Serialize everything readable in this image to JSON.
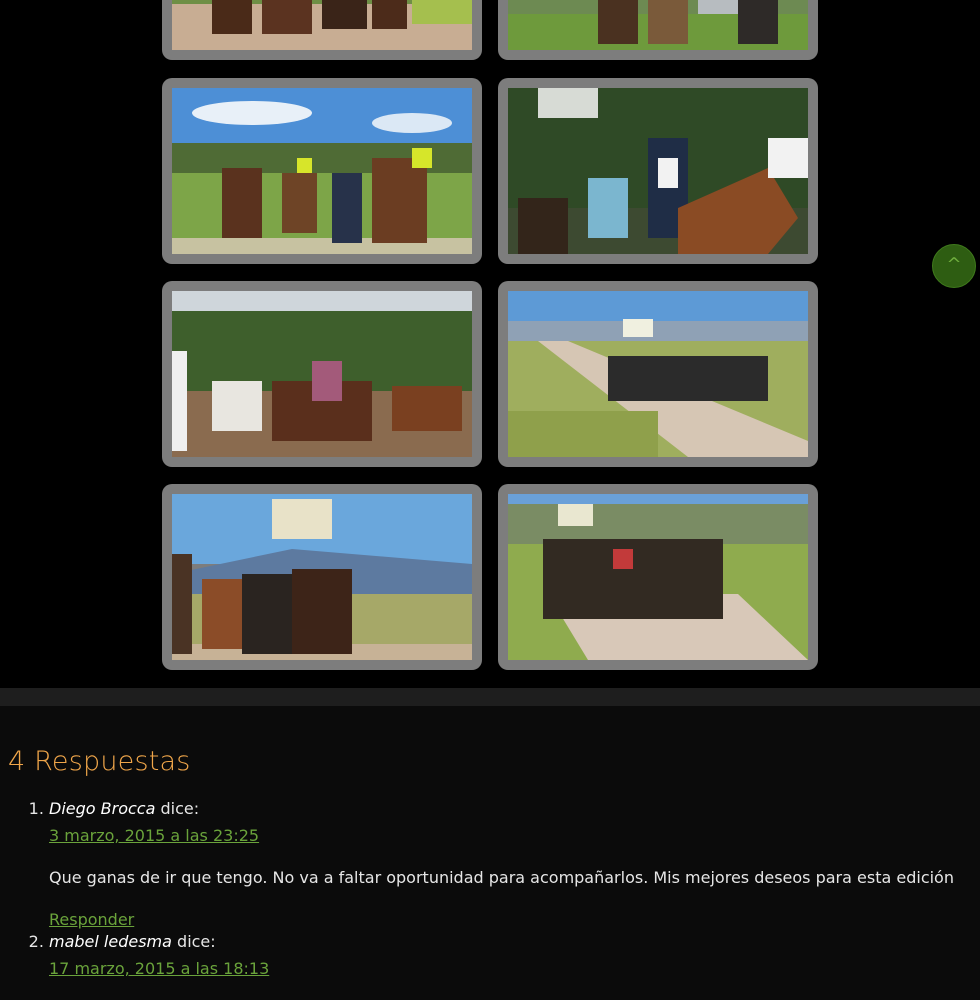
{
  "gallery": {
    "photos": [
      {
        "name": "photo-riders-dirt-road-top-left"
      },
      {
        "name": "photo-riders-with-car-top-right"
      },
      {
        "name": "photo-riders-with-vests-and-flags"
      },
      {
        "name": "photo-woman-on-brown-horse"
      },
      {
        "name": "photo-riders-in-yard"
      },
      {
        "name": "photo-cavalcade-on-road-with-flag"
      },
      {
        "name": "photo-riders-carrying-flag-mountains"
      },
      {
        "name": "photo-cavalcade-approaching-on-road"
      }
    ]
  },
  "to_top_button": {
    "label": "^"
  },
  "comments": {
    "title": "4 Respuestas",
    "items": [
      {
        "author": "Diego Brocca",
        "says": "dice:",
        "date": "3 marzo, 2015 a las 23:25",
        "text": "Que ganas de ir que tengo. No va a faltar oportunidad para acompañarlos. Mis mejores deseos para esta edición",
        "reply": "Responder"
      },
      {
        "author": "mabel ledesma",
        "says": "dice:",
        "date": "17 marzo, 2015 a las 18:13"
      }
    ]
  }
}
